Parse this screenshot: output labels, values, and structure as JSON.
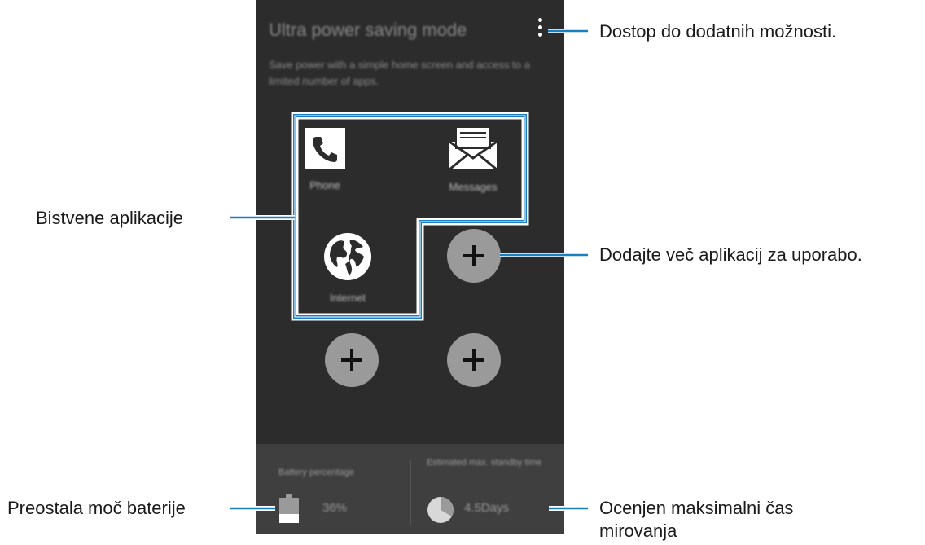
{
  "phone": {
    "title": "Ultra power saving mode",
    "description": "Save power with a simple home screen and access to a limited number of apps.",
    "apps": [
      {
        "label": "Phone",
        "icon": "phone-icon"
      },
      {
        "label": "Messages",
        "icon": "envelope-icon"
      },
      {
        "label": "Internet",
        "icon": "globe-icon"
      }
    ],
    "add_icon": "plus-icon",
    "menu_icon": "more-vertical-icon",
    "battery": {
      "label": "Battery percentage",
      "value": "36%",
      "icon": "battery-icon",
      "level": 0.36
    },
    "standby": {
      "label": "Estimated max. standby time",
      "value": "4.5Days",
      "icon": "pie-clock-icon"
    }
  },
  "callouts": {
    "menu": "Dostop do dodatnih možnosti.",
    "essential_apps": "Bistvene aplikacije",
    "add_apps": "Dodajte več aplikacij za uporabo.",
    "battery": "Preostala moč baterije",
    "standby_line1": "Ocenjen maksimalni čas",
    "standby_line2": "mirovanja"
  },
  "colors": {
    "screen_bg": "#2c2c2c",
    "panel_bg": "#3f3f3f",
    "highlight": "#1a7fc0",
    "add_button": "#9a9a9a"
  }
}
